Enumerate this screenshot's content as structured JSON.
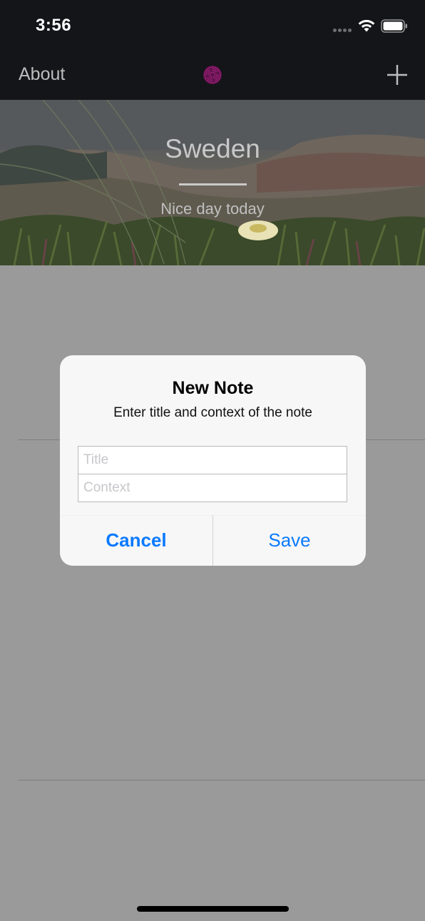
{
  "status_bar": {
    "time": "3:56",
    "icons": [
      "cellular-signal-icon",
      "wifi-icon",
      "battery-icon"
    ]
  },
  "nav": {
    "left_label": "About",
    "center_icon": "fingerprint-logo-icon",
    "right_icon": "plus-icon"
  },
  "hero": {
    "title": "Sweden",
    "subtitle": "Nice day today"
  },
  "alert": {
    "title": "New Note",
    "message": "Enter title and context of the note",
    "fields": [
      {
        "placeholder": "Title",
        "value": ""
      },
      {
        "placeholder": "Context",
        "value": ""
      }
    ],
    "buttons": {
      "cancel": "Cancel",
      "save": "Save"
    }
  },
  "colors": {
    "nav_bg": "#141519",
    "dim_bg": "#9a9a9a",
    "accent_blue": "#0a7aff",
    "logo_magenta": "#8a1a6a"
  }
}
